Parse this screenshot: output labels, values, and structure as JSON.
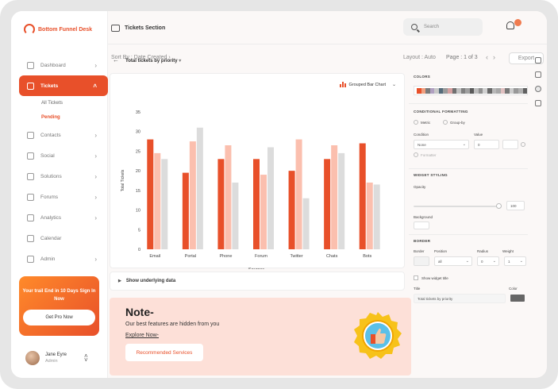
{
  "app": {
    "name": "Bottom Funnel Desk"
  },
  "sidebar": {
    "items": [
      {
        "label": "Dashboard",
        "icon": "dashboard-icon"
      },
      {
        "label": "Tickets",
        "icon": "ticket-icon"
      },
      {
        "label": "Contacts",
        "icon": "contacts-icon"
      },
      {
        "label": "Social",
        "icon": "social-icon"
      },
      {
        "label": "Solutions",
        "icon": "solutions-icon"
      },
      {
        "label": "Forums",
        "icon": "forums-icon"
      },
      {
        "label": "Analytics",
        "icon": "analytics-icon"
      },
      {
        "label": "Calendar",
        "icon": "calendar-icon"
      },
      {
        "label": "Admin",
        "icon": "admin-icon"
      }
    ],
    "subitems": [
      {
        "label": "All Tickets"
      },
      {
        "label": "Pending"
      }
    ],
    "promo": {
      "text": "Your trail End in 10 Days Sign In Now",
      "button": "Get Pro Now"
    },
    "user": {
      "name": "Jane Eyre",
      "role": "Admin"
    }
  },
  "header": {
    "title": "Tickets Section",
    "search_placeholder": "Search",
    "notifications": "1"
  },
  "toolbar": {
    "sort_by": "Sort By : Date Created",
    "layout": "Layout : Auto",
    "page": "Page : 1 of 3",
    "export": "Export"
  },
  "section": {
    "title": "Total tickets by priority"
  },
  "chart_type_label": "Grouped Bar Chart",
  "chart_data": {
    "type": "bar",
    "title": "",
    "xlabel": "Sources",
    "ylabel": "Total Tickets",
    "ylim": [
      0,
      35
    ],
    "yticks": [
      0,
      5,
      10,
      15,
      20,
      25,
      30,
      35
    ],
    "categories": [
      "Email",
      "Portal",
      "Phone",
      "Forum",
      "Twitter",
      "Chats",
      "Bots"
    ],
    "series": [
      {
        "values": [
          28,
          19.5,
          23,
          23,
          20,
          23,
          27
        ],
        "color": "#e8502a"
      },
      {
        "values": [
          24.5,
          27.5,
          26.5,
          19,
          28,
          26.5,
          17
        ],
        "color": "#fbbfae"
      },
      {
        "values": [
          23,
          31,
          17,
          26,
          13,
          24.5,
          16.5
        ],
        "color": "#dcdcdc"
      }
    ]
  },
  "underlying": {
    "label": "Show underlying data"
  },
  "note": {
    "heading": "Note-",
    "subtext": "Our best features are hidden from you",
    "link": "Explore Now-",
    "button": "Recommended Services"
  },
  "settings": {
    "colors_label": "COLORS",
    "palette": [
      "#e8502a",
      "#f0a080",
      "#7a7a7a",
      "#b0a0c0",
      "#c8c8c8",
      "#556b7a",
      "#9a9a9a",
      "#d4a0a0",
      "#707070",
      "#c0c0c0",
      "#808080",
      "#a0a0a0",
      "#5a5a5a",
      "#bcbcbc",
      "#909090",
      "#d0d0d0",
      "#686868",
      "#b8b8b8",
      "#a8a8a8",
      "#e0c0c0",
      "#787878",
      "#cccccc",
      "#989898",
      "#b0b0b0",
      "#606060"
    ],
    "cond_label": "CONDITIONAL FORMATTING",
    "metric": "Metric",
    "groupby": "Group-by",
    "condition_label": "Condition",
    "value_label": "Value",
    "condition_value": "None",
    "value_value": "0",
    "formatter": "Formatter",
    "styling_label": "WIDGET STYLING",
    "opacity_label": "Opacity",
    "opacity_value": "100",
    "background_label": "Background",
    "border_label": "BORDER",
    "border_col": "Border",
    "position_col": "Position",
    "radius_col": "Radius",
    "weight_col": "Weight",
    "position_value": "all",
    "radius_value": "0",
    "weight_value": "1",
    "show_title": "Show widget title",
    "title_col": "Title",
    "color_col": "Color",
    "title_value": "Total tickets by priority"
  }
}
